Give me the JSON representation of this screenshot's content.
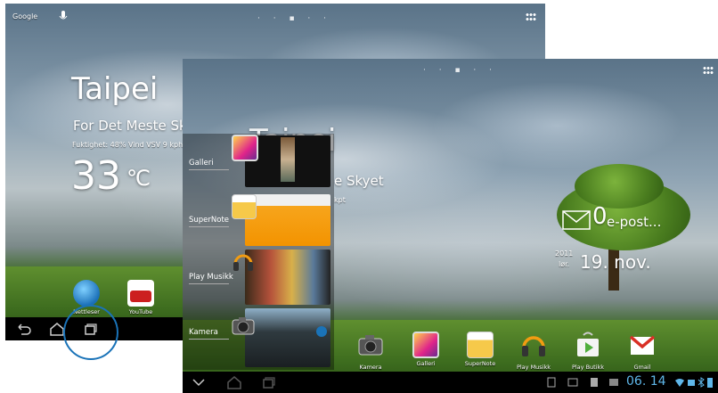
{
  "back_screen": {
    "search_label": "Google",
    "city": "Taipei",
    "condition": "For Det Meste Skyet",
    "details": "Fuktighet: 48% Vind VSV 9 kph",
    "temperature": "33",
    "unit": "℃",
    "apps": [
      {
        "label": "Nettleser",
        "icon": "globe-icon"
      },
      {
        "label": "YouTube",
        "icon": "youtube-icon"
      }
    ]
  },
  "front_screen": {
    "city_ghost": "Taipei",
    "condition_tail": "e Skyet",
    "details_tail": "kpt",
    "recent_apps": [
      {
        "label": "Galleri",
        "icon": "gallery-icon"
      },
      {
        "label": "SuperNote",
        "icon": "supernote-icon"
      },
      {
        "label": "Play Musikk",
        "icon": "headphones-icon"
      },
      {
        "label": "Kamera",
        "icon": "camera-icon"
      }
    ],
    "mail": {
      "count": "0",
      "label": "e-post..."
    },
    "date": {
      "year": "2011",
      "weekday": "lør.",
      "day": "19. nov."
    },
    "dock": [
      {
        "label": "Kamera",
        "icon": "camera-icon"
      },
      {
        "label": "Galleri",
        "icon": "gallery-icon"
      },
      {
        "label": "SuperNote",
        "icon": "supernote-icon"
      },
      {
        "label": "Play Musikk",
        "icon": "headphones-icon"
      },
      {
        "label": "Play Butikk",
        "icon": "play-store-icon"
      },
      {
        "label": "Gmail",
        "icon": "gmail-icon"
      }
    ],
    "status": {
      "time": "06. 14"
    }
  },
  "colors": {
    "highlight_circle": "#1a73b8",
    "navbar": "#000000"
  }
}
